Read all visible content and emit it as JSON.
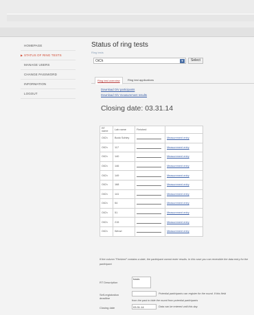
{
  "sidebar": {
    "items": [
      {
        "label": "HOMEPAGE",
        "active": false
      },
      {
        "label": "STATUS OF RING TESTS",
        "active": true
      },
      {
        "label": "MANAGE USERS",
        "active": false
      },
      {
        "label": "CHANGE PASSWORD",
        "active": false
      },
      {
        "label": "INFORMATION",
        "active": false
      },
      {
        "label": "LOGOUT",
        "active": false
      }
    ]
  },
  "main": {
    "title": "Status of ring tests",
    "select_label": "Ring tests",
    "select_value": "OiCh",
    "select_button": "Select",
    "tabs": [
      "Ring test overview",
      "Ring test applications"
    ],
    "links": [
      "Download OiV participants",
      "Download OiV measurement results"
    ],
    "closing_date": "Closing date: 03.31.14",
    "table": {
      "headers": [
        "RT name",
        "Lab name",
        "Finished",
        ""
      ],
      "rows": [
        {
          "rt": "OiCh",
          "lab": "Bodo Schley",
          "link": "Measurement entry"
        },
        {
          "rt": "OiCh",
          "lab": "117",
          "link": "Measurement entry"
        },
        {
          "rt": "OiCh",
          "lab": "140",
          "link": "Measurement entry"
        },
        {
          "rt": "OiCh",
          "lab": "146",
          "link": "Measurement entry"
        },
        {
          "rt": "OiCh",
          "lab": "149",
          "link": "Measurement entry"
        },
        {
          "rt": "OiCh",
          "lab": "168",
          "link": "Measurement entry"
        },
        {
          "rt": "OiCh",
          "lab": "141",
          "link": "Measurement entry"
        },
        {
          "rt": "OiCh",
          "lab": "54",
          "link": "Measurement entry"
        },
        {
          "rt": "OiCh",
          "lab": "51",
          "link": "Measurement entry"
        },
        {
          "rt": "OiCh",
          "lab": "215",
          "link": "Measurement entry"
        },
        {
          "rt": "OiCh",
          "lab": "Wenzl",
          "link": "Measurement entry"
        }
      ]
    },
    "note": "If the column \"Finished\" contains a date, the participant cannot enter results. In this case you can reversible the data entry for the participant.",
    "form": {
      "description_label": "RT Description",
      "description_value": "basis",
      "self_reg_label": "Self-registration deadline",
      "self_reg_hint": "Potential participants can register for the round. If this field",
      "self_reg_hint2": "from the past to hide the round from potential participants",
      "closing_label": "Closing date",
      "closing_value": "03.31.14",
      "closing_hint": "Data can be entered until this day."
    }
  }
}
